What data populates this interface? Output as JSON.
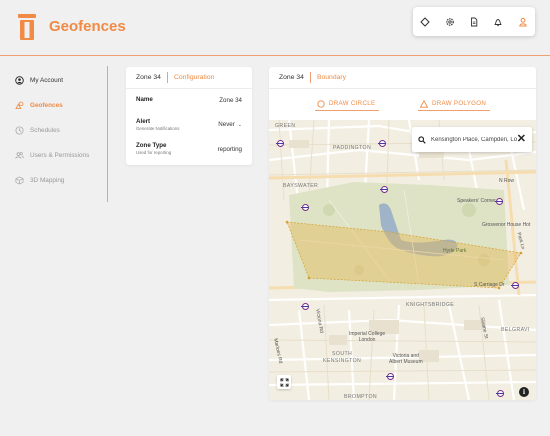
{
  "app": {
    "title": "Geofences",
    "logo": "pillar-logo-icon"
  },
  "toolbar": {
    "icons": [
      "diamond-icon",
      "gear-icon",
      "document-icon",
      "bell-icon",
      "user-icon"
    ]
  },
  "sidebar": {
    "items": [
      {
        "label": "My Account",
        "icon": "account-circle-icon"
      },
      {
        "label": "Geofences",
        "icon": "shapes-icon",
        "active": true
      },
      {
        "label": "Schedules",
        "icon": "clock-icon"
      },
      {
        "label": "Users & Permissions",
        "icon": "users-icon"
      },
      {
        "label": "3D Mapping",
        "icon": "cube-icon"
      }
    ]
  },
  "config": {
    "zone": "Zone 34",
    "section": "Configuration",
    "name_label": "Name",
    "name_value": "Zone 34",
    "alert_label": "Alert",
    "alert_sub": "Generate Notifications",
    "alert_value": "Never",
    "type_label": "Zone Type",
    "type_sub": "Used for reporting",
    "type_value": "reporting"
  },
  "boundary": {
    "zone": "Zone 34",
    "section": "Boundary",
    "draw_circle": "DRAW CIRCLE",
    "draw_polygon": "DRAW POLYGON"
  },
  "map": {
    "search_value": "Kensington Place, Campden, London",
    "labels": {
      "green": "GREEN",
      "paddington": "PADDINGTON",
      "bayswater": "BAYSWATER",
      "speakers_corner": "Speakers' Corner",
      "grosvenor": "Grosvenor House Hot",
      "hyde_park": "Hyde Park",
      "park_ln": "Park Ln",
      "n_row": "N Row",
      "carriage_dr": "S Carriage Dr",
      "knightsbridge": "KNIGHTSBRIDGE",
      "belgravia": "BELGRAVI",
      "imperial": "Imperial College\nLondon",
      "victoria_albert": "Victoria and\nAlbert Museum",
      "south_kensington": "SOUTH\nKENSINGTON",
      "brompton": "BROMPTON",
      "victoria_rd": "Victoria Rd",
      "marloes_rd": "Marloes Rd",
      "sloane_st": "Sloane St"
    }
  },
  "colors": {
    "accent": "#f08a44",
    "park": "#dde3c4",
    "water": "#9fb4c7",
    "polygon": "#e6b95b"
  }
}
